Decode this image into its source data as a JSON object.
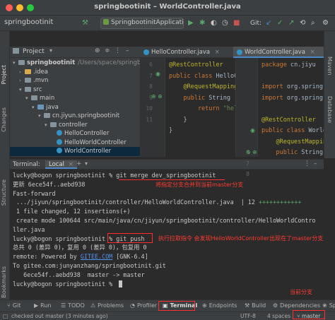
{
  "window": {
    "title": "springbootinit – WorldController.java"
  },
  "toolbar": {
    "breadcrumb": "springbootinit",
    "run_config": "SpringbootinitApplication",
    "git_label": "Git:"
  },
  "left_strip": {
    "project": "Project",
    "changes": "Changes",
    "structure": "Structure",
    "bookmarks": "Bookmarks"
  },
  "right_strip": {
    "maven": "Maven",
    "database": "Database"
  },
  "project_panel": {
    "header": "Project",
    "tree": [
      {
        "label": "springbootinit",
        "extra": "/Users/space/springbootin",
        "indent": 0,
        "icon": "folder",
        "arrow": "▾"
      },
      {
        "label": ".idea",
        "extra": "",
        "indent": 1,
        "icon": "folder-orange",
        "arrow": "›"
      },
      {
        "label": ".mvn",
        "extra": "",
        "indent": 1,
        "icon": "folder",
        "arrow": "›"
      },
      {
        "label": "src",
        "extra": "",
        "indent": 1,
        "icon": "folder",
        "arrow": "▾"
      },
      {
        "label": "main",
        "extra": "",
        "indent": 2,
        "icon": "folder",
        "arrow": "▾"
      },
      {
        "label": "java",
        "extra": "",
        "indent": 3,
        "icon": "folder-blue",
        "arrow": "▾"
      },
      {
        "label": "cn.jiyun.springbootinit",
        "extra": "",
        "indent": 4,
        "icon": "folder",
        "arrow": "▾"
      },
      {
        "label": "controller",
        "extra": "",
        "indent": 5,
        "icon": "folder",
        "arrow": "▾"
      },
      {
        "label": "HelloController",
        "extra": "",
        "indent": 6,
        "icon": "class",
        "arrow": ""
      },
      {
        "label": "HelloWorldController",
        "extra": "",
        "indent": 6,
        "icon": "class",
        "arrow": ""
      },
      {
        "label": "WorldController",
        "extra": "",
        "indent": 6,
        "icon": "class",
        "arrow": ""
      }
    ]
  },
  "editor": {
    "tabs": [
      {
        "label": "HelloController.java",
        "active": false
      },
      {
        "label": "WorldController.java",
        "active": true
      }
    ],
    "left_pane": {
      "line_numbers": [
        "6",
        "7",
        "8",
        "9",
        "10",
        "11"
      ],
      "lines": [
        [
          {
            "t": "@RestController",
            "c": "an"
          }
        ],
        [
          {
            "t": "public class ",
            "c": "kw"
          },
          {
            "t": "HelloC",
            "c": "tx"
          }
        ],
        [
          {
            "t": "    @RequestMapping",
            "c": "an"
          }
        ],
        [
          {
            "t": "    public ",
            "c": "kw"
          },
          {
            "t": "String ",
            "c": "tx"
          }
        ],
        [
          {
            "t": "        return ",
            "c": "kw"
          },
          {
            "t": "\"hel",
            "c": "st"
          }
        ],
        [
          {
            "t": "    }",
            "c": "tx"
          }
        ],
        [
          {
            "t": "}",
            "c": "tx"
          }
        ]
      ]
    },
    "right_pane": {
      "line_numbers": [
        "",
        "",
        "",
        "6",
        "7",
        "8"
      ],
      "lines": [
        [
          {
            "t": "package ",
            "c": "kw"
          },
          {
            "t": "cn.jiyu",
            "c": "tx"
          }
        ],
        [
          {
            "t": "",
            "c": "tx"
          }
        ],
        [
          {
            "t": "import ",
            "c": "kw"
          },
          {
            "t": "org.springf",
            "c": "tx"
          }
        ],
        [
          {
            "t": "import ",
            "c": "kw"
          },
          {
            "t": "org.springf",
            "c": "tx"
          }
        ],
        [
          {
            "t": "",
            "c": "tx"
          }
        ],
        [
          {
            "t": "@RestController",
            "c": "an"
          }
        ],
        [
          {
            "t": "public class ",
            "c": "kw"
          },
          {
            "t": "World",
            "c": "tx"
          }
        ],
        [
          {
            "t": "    @RequestMappin",
            "c": "an"
          }
        ],
        [
          {
            "t": "    public ",
            "c": "kw"
          },
          {
            "t": "String ",
            "c": "tx"
          }
        ]
      ]
    }
  },
  "terminal": {
    "header_label": "Terminal:",
    "tab_local": "Local",
    "lines": [
      "lucky@bogon springbootinit % git merge dev_springbootinit",
      "更新 6ece54f..aebd938",
      "Fast-forward",
      " .../jiyun/springbootinit/controller/HelloWorldController.java  | 12 ++++++++++++",
      " 1 file changed, 12 insertions(+)",
      " create mode 100644 src/main/java/cn/jiyun/springbootinit/controller/HelloWorldContro",
      "ller.java",
      "lucky@bogon springbootinit % git push",
      "总共 0 (差异 0)，复用 0 (差异 0)，包复用 0",
      "remote: Powered by GITEE.COM [GNK-6.4]",
      "To gitee.com:junyanzhang/springbootinit.git",
      "   6ece54f..aebd938  master -> master",
      "lucky@bogon springbootinit % "
    ],
    "annotations": {
      "merge_note": "将指定分支合并到当前master分支",
      "push_note": "执行拉取指令 会发现HelloWorldController出现在了master分支上",
      "branch_note": "当前分支"
    }
  },
  "bottom_tools": [
    {
      "label": "Git",
      "icon": "git-icon"
    },
    {
      "label": "Run",
      "icon": "run-icon"
    },
    {
      "label": "TODO",
      "icon": "todo-icon"
    },
    {
      "label": "Problems",
      "icon": "problems-icon"
    },
    {
      "label": "Profiler",
      "icon": "profiler-icon"
    },
    {
      "label": "Terminal",
      "icon": "terminal-icon"
    },
    {
      "label": "Endpoints",
      "icon": "endpoints-icon"
    },
    {
      "label": "Build",
      "icon": "build-icon"
    },
    {
      "label": "Dependencies",
      "icon": "dependencies-icon"
    },
    {
      "label": "Sp",
      "icon": "spring-icon"
    }
  ],
  "status_bar": {
    "message": "checked out master (3 minutes ago)",
    "encoding": "UTF-8",
    "indent": "4 spaces",
    "branch": "master"
  },
  "colors": {
    "accent_red": "#ff2d2d",
    "selection": "#0d293e",
    "active_tab": "#4a88c7"
  }
}
